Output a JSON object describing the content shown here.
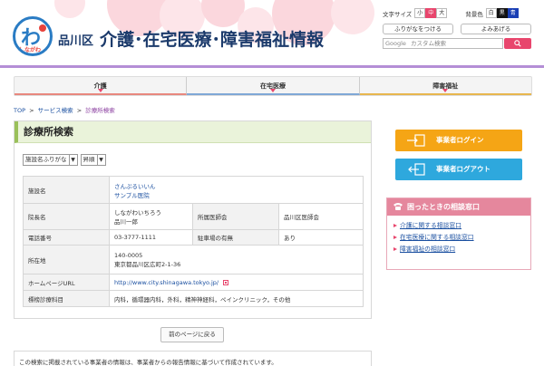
{
  "header": {
    "ward": "品川区",
    "title": "介護･在宅医療･障害福祉情報",
    "logo_text": "わ",
    "logo_sub": "しながわ",
    "font_size_label": "文字サイズ",
    "font_sizes": [
      "小",
      "中",
      "大"
    ],
    "bg_label": "背景色",
    "bg_options": [
      "白",
      "黒",
      "青"
    ],
    "furigana_button": "ふりがなをつける",
    "yomiage_button": "よみあげる",
    "search_placeholder": "カスタム検索",
    "search_brand": "Google"
  },
  "nav": {
    "items": [
      "介護",
      "在宅医療",
      "障害福祉"
    ]
  },
  "breadcrumb": {
    "items": [
      "TOP",
      "サービス検索",
      "診療所検索"
    ]
  },
  "main": {
    "title": "診療所検索",
    "sort_select": "施設名ふりがな",
    "order_select": "昇順",
    "rows": {
      "facility_label": "施設名",
      "facility_kana": "さんぷるいいん",
      "facility_name": "サンプル医院",
      "director_label": "院長名",
      "director_kana": "しながわいちろう",
      "director_name": "品川一郎",
      "assoc_label": "所属医師会",
      "assoc_value": "品川区医師会",
      "phone_label": "電話番号",
      "phone_value": "03-3777-1111",
      "parking_label": "駐車場の有無",
      "parking_value": "あり",
      "address_label": "所在地",
      "postal": "140-0005",
      "address": "東京都品川区広町2-1-36",
      "homepage_label": "ホームページURL",
      "homepage_url": "http://www.city.shinagawa.tokyo.jp/",
      "dept_label": "標榜診療科目",
      "dept_value": "内科，循環器内科，外科，精神神経科，ペインクリニック，その他"
    },
    "back_button": "前のページに戻る",
    "note": "この検索に掲載されている事業者の情報は、事業者からの報告情報に基づいて作成されています。"
  },
  "sidebar": {
    "login_button": "事業者ログイン",
    "logout_button": "事業者ログアウト",
    "consult_title": "困ったときの相談窓口",
    "consult_links": [
      "介護に関する相談窓口",
      "在宅医療に関する相談窓口",
      "障害福祉の相談窓口"
    ]
  },
  "colors": {
    "accent_pink": "#e8466d",
    "title_navy": "#1b3a6b",
    "login_orange": "#f5a515",
    "logout_blue": "#2ea8dd"
  }
}
